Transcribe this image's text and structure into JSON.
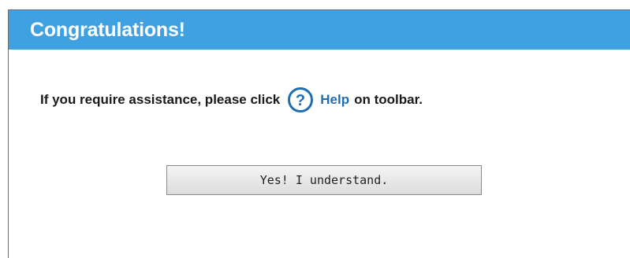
{
  "dialog": {
    "title": "Congratulations!",
    "message_before": "If you require assistance, please click",
    "help_icon": "help-question-circle-icon",
    "help_link": "Help",
    "message_after": "on toolbar.",
    "confirm_button": "Yes! I understand."
  },
  "colors": {
    "title_bar": "#3fa1e1",
    "title_text": "#ffffff",
    "help_link": "#1f6db3",
    "help_icon": "#1f6db3"
  }
}
